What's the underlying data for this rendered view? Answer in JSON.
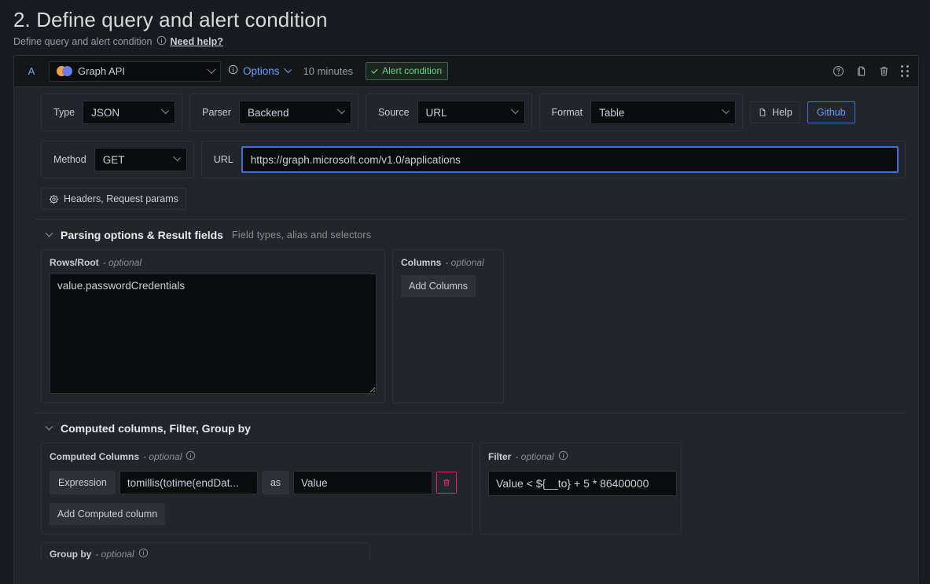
{
  "header": {
    "title": "2. Define query and alert condition",
    "subtitle": "Define query and alert condition",
    "info_icon": "info-circle-icon",
    "need_help": "Need help?"
  },
  "query": {
    "ref_id": "A",
    "datasource": {
      "name": "Graph API",
      "icon": "infinity-datasource-icon",
      "chevron": "chevron-down-icon"
    },
    "options_info_icon": "info-circle-icon",
    "options_label": "Options",
    "options_chevron": "chevron-down-icon",
    "interval": "10 minutes",
    "alert_condition": {
      "label": "Alert condition",
      "check_icon": "check-icon",
      "color": "#6ccf8e"
    },
    "actions": [
      {
        "name": "help-icon",
        "glyph": "?"
      },
      {
        "name": "copy-icon",
        "glyph": "copy"
      },
      {
        "name": "trash-icon",
        "glyph": "trash"
      },
      {
        "name": "drag-handle-icon",
        "glyph": "dots"
      }
    ]
  },
  "row1": {
    "type": {
      "label": "Type",
      "value": "JSON"
    },
    "parser": {
      "label": "Parser",
      "value": "Backend"
    },
    "source": {
      "label": "Source",
      "value": "URL"
    },
    "format": {
      "label": "Format",
      "value": "Table"
    },
    "help_button": "Help",
    "help_icon": "file-doc-icon",
    "github_button": "Github"
  },
  "row2": {
    "method": {
      "label": "Method",
      "value": "GET"
    },
    "url": {
      "label": "URL",
      "value": "https://graph.microsoft.com/v1.0/applications"
    }
  },
  "headers_button": {
    "label": "Headers, Request params",
    "icon": "gear-icon"
  },
  "parsing_section": {
    "title": "Parsing options & Result fields",
    "description": "Field types, alias and selectors",
    "caret": "chevron-down-icon",
    "rows_root": {
      "label": "Rows/Root",
      "optional": "- optional",
      "value": "value.passwordCredentials"
    },
    "columns": {
      "label": "Columns",
      "optional": "- optional",
      "add_button": "Add Columns"
    }
  },
  "computed_section": {
    "title": "Computed columns, Filter, Group by",
    "caret": "chevron-down-icon",
    "computed_columns": {
      "label": "Computed Columns",
      "optional": "- optional",
      "info_icon": "info-circle-icon",
      "expression_tag": "Expression",
      "expression_value": "tomillis(totime(endDat...",
      "as_tag": "as",
      "alias_value": "Value",
      "delete_icon": "trash-icon",
      "delete_color": "#e0226e",
      "add_button": "Add Computed column"
    },
    "filter": {
      "label": "Filter",
      "optional": "- optional",
      "info_icon": "info-circle-icon",
      "value": "Value < ${__to} + 5 * 86400000"
    },
    "group_by": {
      "label": "Group by",
      "optional": "- optional",
      "info_icon": "info-circle-icon"
    }
  },
  "theme": {
    "page_bg": "#181b1f",
    "panel_bg": "#22252b",
    "header_bg": "#141619",
    "input_bg": "#0b0c0e",
    "border": "#2c3235",
    "accent_blue": "#6e9fff",
    "focus_blue": "#3d71d9",
    "text": "#ccccdc",
    "muted": "#8e8e8e"
  }
}
